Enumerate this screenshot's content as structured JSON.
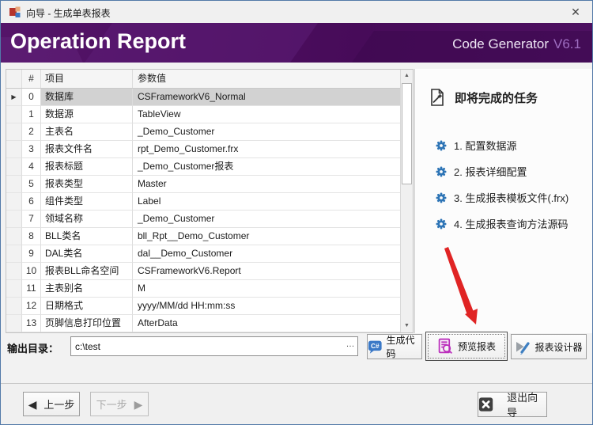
{
  "window": {
    "title": "向导 - 生成单表报表"
  },
  "banner": {
    "title": "Operation Report",
    "brand": "Code Generator",
    "version": "V6.1"
  },
  "table": {
    "columns": [
      "#",
      "项目",
      "参数值"
    ],
    "rows": [
      {
        "n": "0",
        "item": "数据库",
        "value": "CSFrameworkV6_Normal",
        "selected": true
      },
      {
        "n": "1",
        "item": "数据源",
        "value": "TableView"
      },
      {
        "n": "2",
        "item": "主表名",
        "value": "_Demo_Customer"
      },
      {
        "n": "3",
        "item": "报表文件名",
        "value": "rpt_Demo_Customer.frx"
      },
      {
        "n": "4",
        "item": "报表标题",
        "value": "_Demo_Customer报表"
      },
      {
        "n": "5",
        "item": "报表类型",
        "value": "Master"
      },
      {
        "n": "6",
        "item": "组件类型",
        "value": "Label"
      },
      {
        "n": "7",
        "item": "领域名称",
        "value": "_Demo_Customer"
      },
      {
        "n": "8",
        "item": "BLL类名",
        "value": "bll_Rpt__Demo_Customer"
      },
      {
        "n": "9",
        "item": "DAL类名",
        "value": "dal__Demo_Customer"
      },
      {
        "n": "10",
        "item": "报表BLL命名空间",
        "value": "CSFrameworkV6.Report"
      },
      {
        "n": "11",
        "item": "主表别名",
        "value": "M"
      },
      {
        "n": "12",
        "item": "日期格式",
        "value": "yyyy/MM/dd HH:mm:ss"
      },
      {
        "n": "13",
        "item": "页脚信息打印位置",
        "value": "AfterData"
      }
    ]
  },
  "tasks": {
    "heading": "即将完成的任务",
    "items": [
      "1. 配置数据源",
      "2. 报表详细配置",
      "3. 生成报表模板文件(.frx)",
      "4. 生成报表查询方法源码"
    ]
  },
  "output": {
    "label": "输出目录：",
    "value": "c:\\test"
  },
  "actions": {
    "generate_code": "生成代码",
    "preview_report": "预览报表",
    "report_designer": "报表设计器"
  },
  "nav": {
    "prev": "上一步",
    "next": "下一步",
    "exit": "退出向导"
  },
  "icons": {
    "close": "✕",
    "browse": "…",
    "row_indicator": "▶",
    "scroll_up": "▲",
    "scroll_down": "▼",
    "prev_arrow": "◀",
    "next_arrow": "▶"
  },
  "colors": {
    "banner_purple": "#470b59",
    "version_purple": "#9f6fc2",
    "gear_blue": "#2e75b6",
    "arrow_red": "#e02424",
    "csharp_blue": "#3b79c7",
    "preview_magenta": "#bb2fbc",
    "selection_gray": "#d2d2d2"
  }
}
